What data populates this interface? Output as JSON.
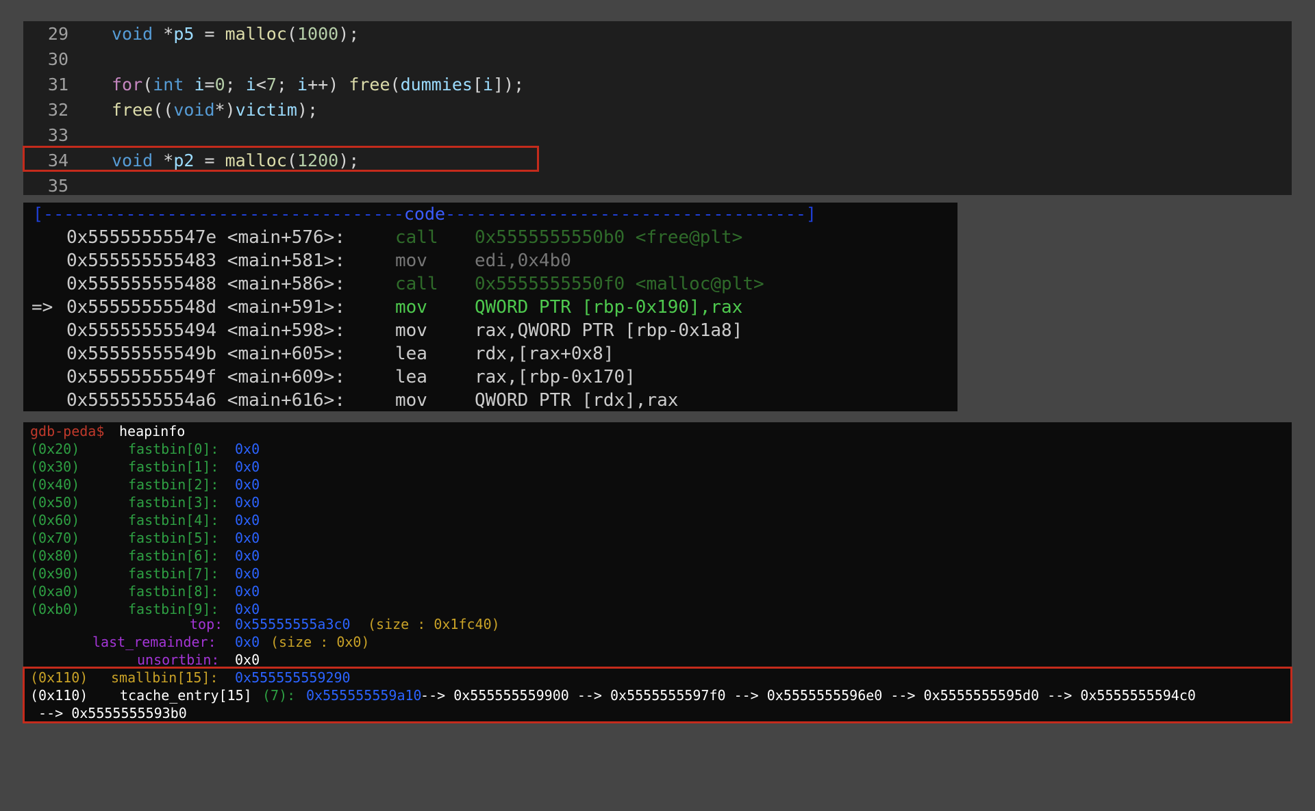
{
  "editor": {
    "lines": [
      {
        "num": "29",
        "tokens": [
          [
            "kw",
            "void"
          ],
          [
            "plain",
            " *"
          ],
          [
            "var",
            "p5"
          ],
          [
            "plain",
            " = "
          ],
          [
            "fn",
            "malloc"
          ],
          [
            "plain",
            "("
          ],
          [
            "num",
            "1000"
          ],
          [
            "plain",
            ");"
          ]
        ]
      },
      {
        "num": "30",
        "tokens": []
      },
      {
        "num": "31",
        "tokens": [
          [
            "ctl",
            "for"
          ],
          [
            "plain",
            "("
          ],
          [
            "kw",
            "int"
          ],
          [
            "plain",
            " "
          ],
          [
            "var",
            "i"
          ],
          [
            "plain",
            "="
          ],
          [
            "num",
            "0"
          ],
          [
            "plain",
            "; "
          ],
          [
            "var",
            "i"
          ],
          [
            "plain",
            "<"
          ],
          [
            "num",
            "7"
          ],
          [
            "plain",
            "; "
          ],
          [
            "var",
            "i"
          ],
          [
            "plain",
            "++) "
          ],
          [
            "fn",
            "free"
          ],
          [
            "plain",
            "("
          ],
          [
            "var",
            "dummies"
          ],
          [
            "plain",
            "["
          ],
          [
            "var",
            "i"
          ],
          [
            "plain",
            "]);"
          ]
        ]
      },
      {
        "num": "32",
        "tokens": [
          [
            "fn",
            "free"
          ],
          [
            "plain",
            "(("
          ],
          [
            "kw",
            "void"
          ],
          [
            "plain",
            "*)"
          ],
          [
            "var",
            "victim"
          ],
          [
            "plain",
            ");"
          ]
        ]
      },
      {
        "num": "33",
        "tokens": []
      },
      {
        "num": "34",
        "tokens": [
          [
            "kw",
            "void"
          ],
          [
            "plain",
            " *"
          ],
          [
            "var",
            "p2"
          ],
          [
            "plain",
            " = "
          ],
          [
            "fn",
            "malloc"
          ],
          [
            "plain",
            "("
          ],
          [
            "num",
            "1200"
          ],
          [
            "plain",
            ");"
          ]
        ]
      },
      {
        "num": "35",
        "tokens": []
      }
    ]
  },
  "disasm": {
    "header_left": "[-----------------------------------",
    "header_tag": "code",
    "header_right": "-----------------------------------]",
    "lines": [
      {
        "arrow": "",
        "addr": "0x55555555547e <main+576>:",
        "op": "call",
        "args": "0x5555555550b0 <free@plt>",
        "style": "dimgreen"
      },
      {
        "arrow": "",
        "addr": "0x555555555483 <main+581>:",
        "op": "mov",
        "args": "edi,0x4b0",
        "style": "dim"
      },
      {
        "arrow": "",
        "addr": "0x555555555488 <main+586>:",
        "op": "call",
        "args": "0x5555555550f0 <malloc@plt>",
        "style": "dimgreen"
      },
      {
        "arrow": "=>",
        "addr": "0x55555555548d <main+591>:",
        "op": "mov",
        "args": "QWORD PTR [rbp-0x190],rax",
        "style": "current"
      },
      {
        "arrow": "",
        "addr": "0x555555555494 <main+598>:",
        "op": "mov",
        "args": "rax,QWORD PTR [rbp-0x1a8]",
        "style": "normal"
      },
      {
        "arrow": "",
        "addr": "0x55555555549b <main+605>:",
        "op": "lea",
        "args": "rdx,[rax+0x8]",
        "style": "normal"
      },
      {
        "arrow": "",
        "addr": "0x55555555549f <main+609>:",
        "op": "lea",
        "args": "rax,[rbp-0x170]",
        "style": "normal"
      },
      {
        "arrow": "",
        "addr": "0x5555555554a6 <main+616>:",
        "op": "mov",
        "args": "QWORD PTR [rdx],rax",
        "style": "normal"
      }
    ]
  },
  "terminal": {
    "prompt": "gdb-peda$",
    "command": "heapinfo",
    "fastbins": [
      {
        "size": "(0x20)",
        "label": "fastbin[0]:",
        "value": "0x0"
      },
      {
        "size": "(0x30)",
        "label": "fastbin[1]:",
        "value": "0x0"
      },
      {
        "size": "(0x40)",
        "label": "fastbin[2]:",
        "value": "0x0"
      },
      {
        "size": "(0x50)",
        "label": "fastbin[3]:",
        "value": "0x0"
      },
      {
        "size": "(0x60)",
        "label": "fastbin[4]:",
        "value": "0x0"
      },
      {
        "size": "(0x70)",
        "label": "fastbin[5]:",
        "value": "0x0"
      },
      {
        "size": "(0x80)",
        "label": "fastbin[6]:",
        "value": "0x0"
      },
      {
        "size": "(0x90)",
        "label": "fastbin[7]:",
        "value": "0x0"
      },
      {
        "size": "(0xa0)",
        "label": "fastbin[8]:",
        "value": "0x0"
      },
      {
        "size": "(0xb0)",
        "label": "fastbin[9]:",
        "value": "0x0"
      }
    ],
    "top": {
      "label": "top:",
      "value": "0x55555555a3c0",
      "size": "(size : 0x1fc40)"
    },
    "last_remainder": {
      "label": "last_remainder:",
      "value": "0x0",
      "size": "(size : 0x0)"
    },
    "unsortbin": {
      "label": "unsortbin:",
      "value": "0x0"
    },
    "smallbin": {
      "size": "(0x110)",
      "label": "smallbin[15]:",
      "value": "0x555555559290"
    },
    "tcache": {
      "size": "(0x110)",
      "label": "tcache_entry[15]",
      "count": "(7):",
      "head": "0x555555559a10",
      "chain1": " --> 0x555555559900 --> 0x5555555597f0 --> 0x5555555596e0 --> 0x5555555595d0 --> 0x5555555594c0",
      "chain2": " --> 0x5555555593b0"
    }
  }
}
